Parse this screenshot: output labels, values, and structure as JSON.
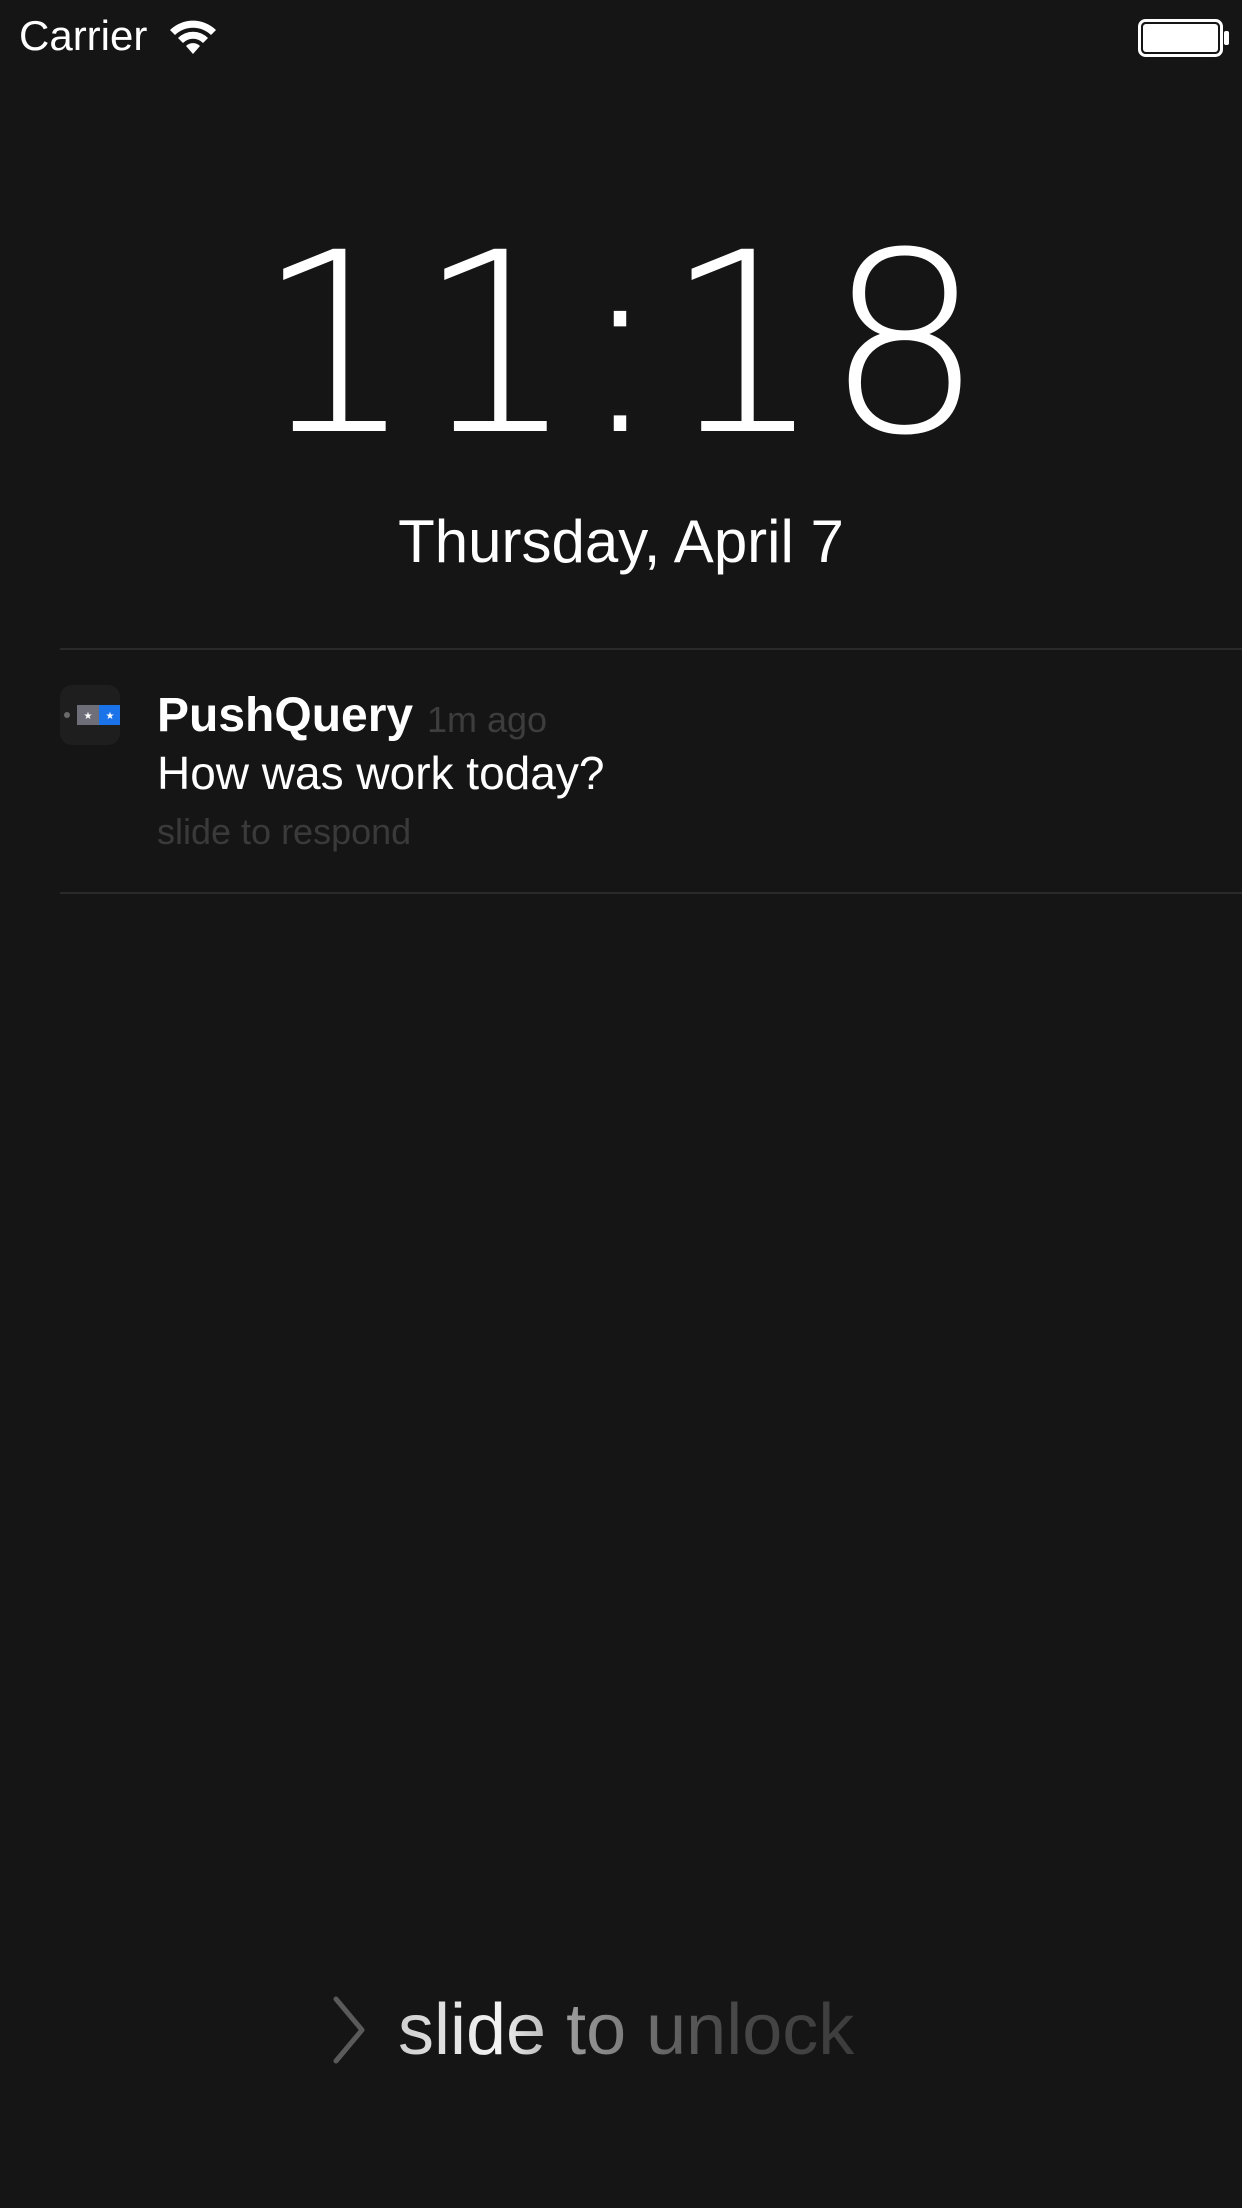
{
  "status_bar": {
    "carrier": "Carrier",
    "wifi_icon": "wifi-icon",
    "battery_icon": "battery-icon"
  },
  "lock_screen": {
    "time": "11:18",
    "date": "Thursday, April 7"
  },
  "notification": {
    "app_icon": "pushquery-app-icon",
    "app_name": "PushQuery",
    "time_ago": "1m ago",
    "message": "How was work today?",
    "action_hint": "slide to respond"
  },
  "unlock": {
    "chevron_icon": "chevron-right-icon",
    "label": "slide to unlock"
  },
  "colors": {
    "background": "#151515",
    "divider": "#2a2a2a",
    "muted_text": "#3d3d3d",
    "icon_blue": "#1a73e8"
  }
}
